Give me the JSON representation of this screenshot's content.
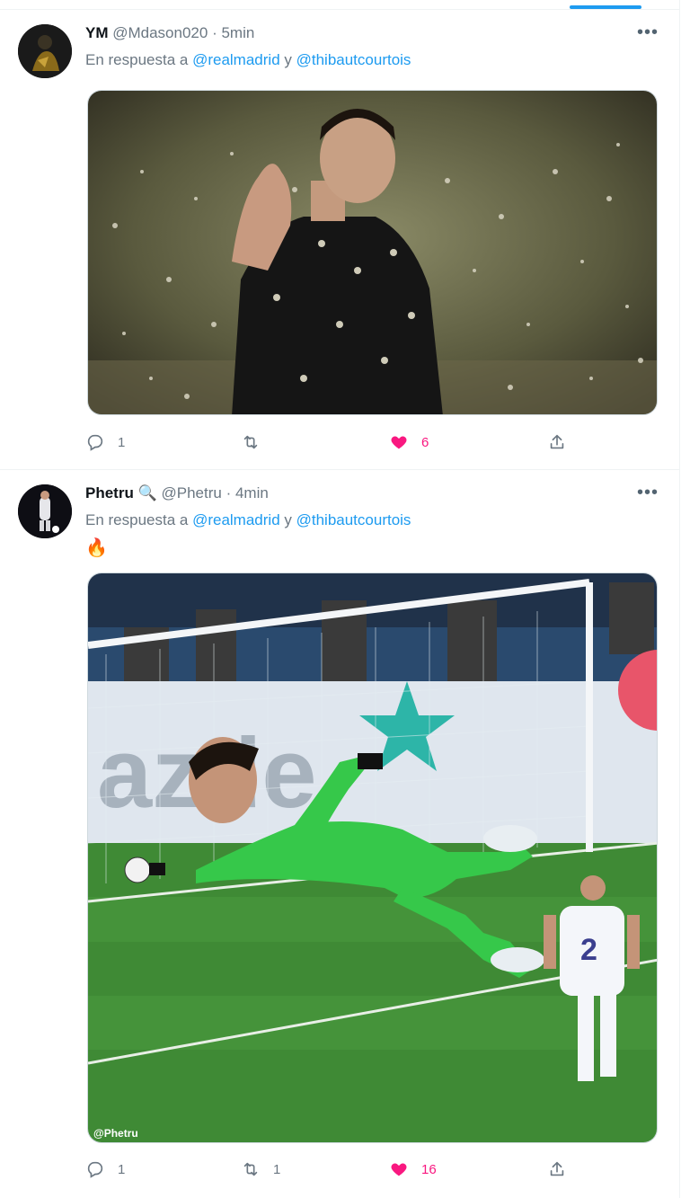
{
  "tweets": [
    {
      "name": "YM⁣",
      "handle": "@Mdason020",
      "sep": " · ",
      "time": "5min",
      "reply_prefix": "En respuesta a ",
      "mention_1": "@realmadrid",
      "reply_join": " y ",
      "mention_2": "@thibautcourtois",
      "text": "",
      "replies": "1",
      "retweets": "",
      "likes": "6",
      "liked": true
    },
    {
      "name": "Phetru",
      "badge": "🔍",
      "handle": "@Phetru",
      "sep": " · ",
      "time": "4min",
      "reply_prefix": "En respuesta a ",
      "mention_1": "@realmadrid",
      "reply_join": " y ",
      "mention_2": "@thibautcourtois",
      "text": "🔥",
      "replies": "1",
      "retweets": "1",
      "likes": "16",
      "liked": true,
      "watermark": "@Phetru"
    }
  ],
  "colors": {
    "accent": "#1d9bf0",
    "like": "#f91880",
    "muted": "#6b7782"
  }
}
